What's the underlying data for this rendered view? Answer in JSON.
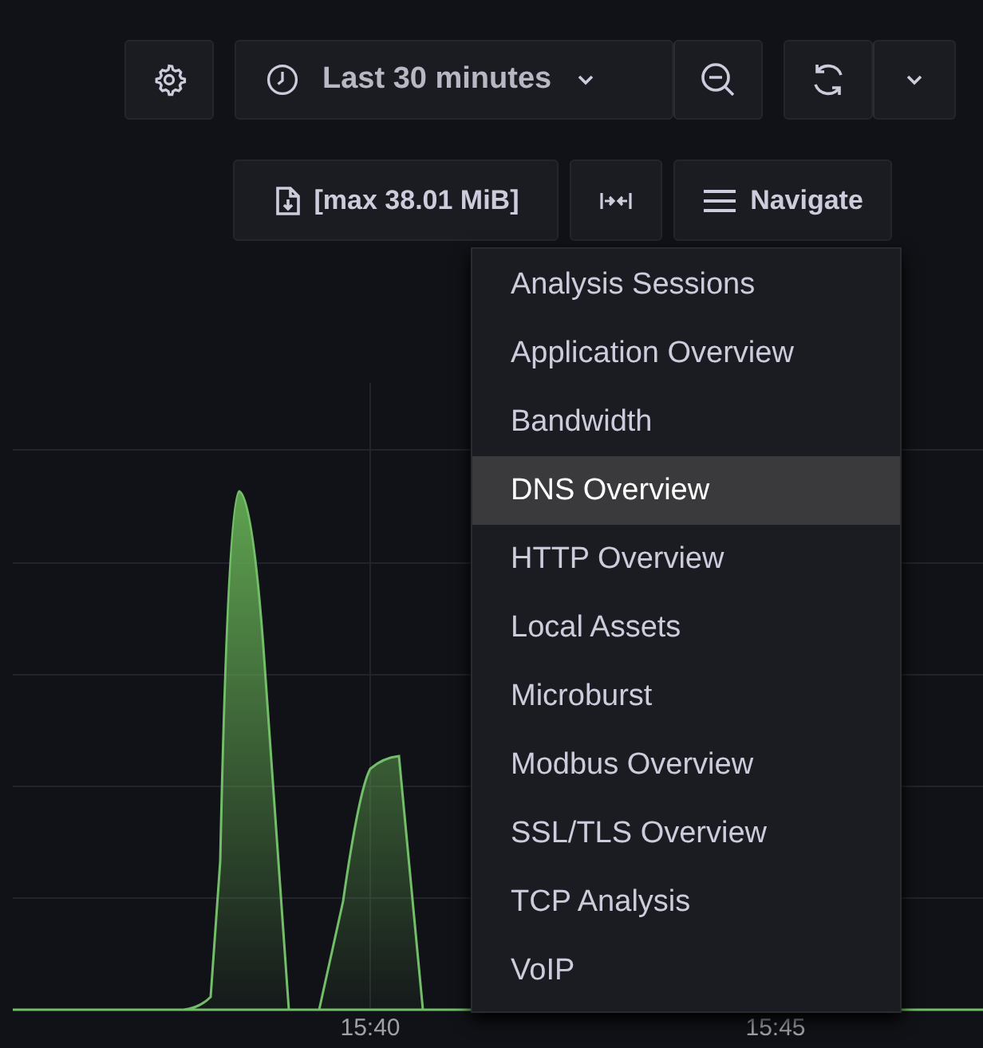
{
  "toolbar": {
    "time_range": "Last 30 minutes"
  },
  "export": {
    "label": "[max 38.01 MiB]"
  },
  "navigate": {
    "label": "Navigate"
  },
  "menu": {
    "items": [
      {
        "label": "Analysis Sessions",
        "selected": false
      },
      {
        "label": "Application Overview",
        "selected": false
      },
      {
        "label": "Bandwidth",
        "selected": false
      },
      {
        "label": "DNS Overview",
        "selected": true
      },
      {
        "label": "HTTP Overview",
        "selected": false
      },
      {
        "label": "Local Assets",
        "selected": false
      },
      {
        "label": "Microburst",
        "selected": false
      },
      {
        "label": "Modbus Overview",
        "selected": false
      },
      {
        "label": "SSL/TLS Overview",
        "selected": false
      },
      {
        "label": "TCP Analysis",
        "selected": false
      },
      {
        "label": "VoIP",
        "selected": false
      }
    ]
  },
  "chart": {
    "x_labels": [
      "15:40",
      "15:45"
    ]
  }
}
